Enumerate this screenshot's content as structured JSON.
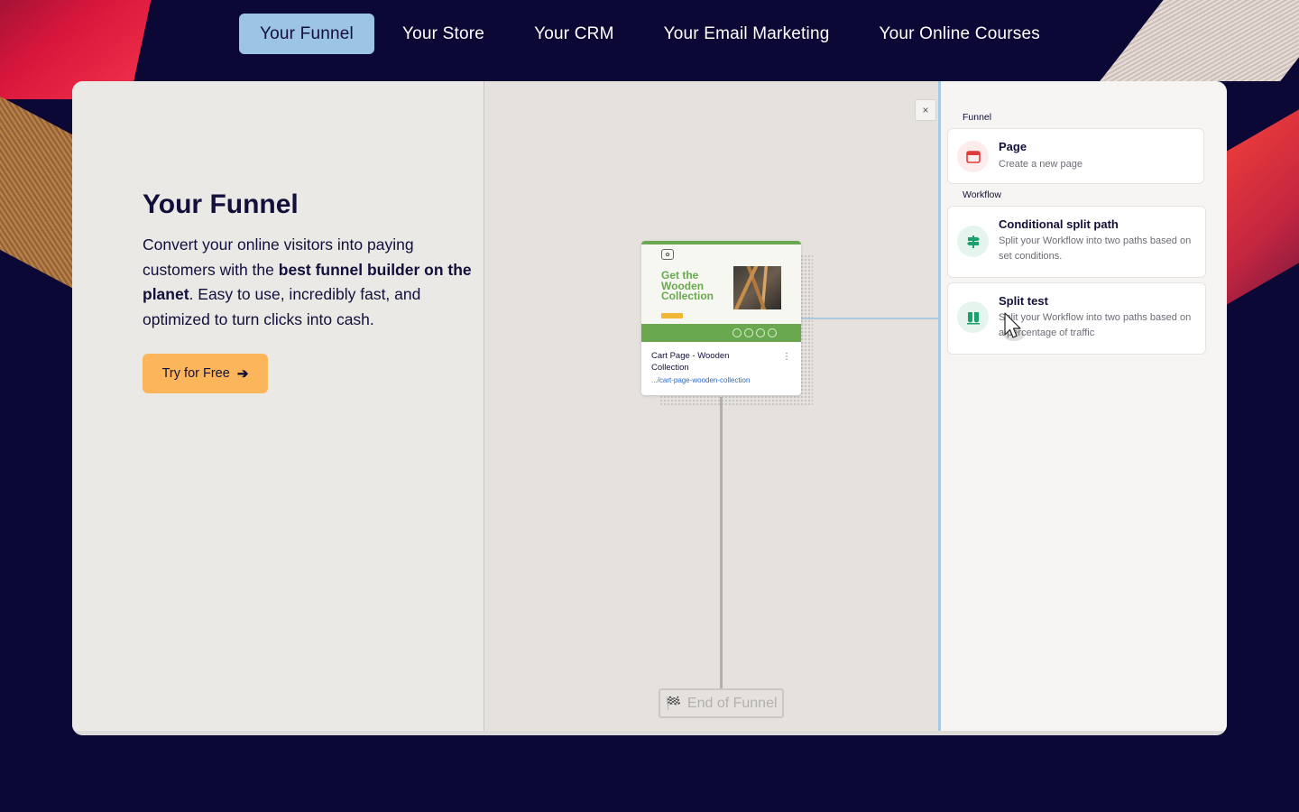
{
  "nav": {
    "tabs": [
      {
        "label": "Your Funnel",
        "active": true
      },
      {
        "label": "Your Store",
        "active": false
      },
      {
        "label": "Your CRM",
        "active": false
      },
      {
        "label": "Your Email Marketing",
        "active": false
      },
      {
        "label": "Your Online Courses",
        "active": false
      }
    ]
  },
  "hero": {
    "title": "Your Funnel",
    "desc_part1": "Convert your online visitors into paying customers with the ",
    "desc_bold": "best funnel builder on the planet",
    "desc_part2": ". Easy to use, incredibly fast, and optimized to turn clicks into cash.",
    "cta_label": "Try for Free",
    "cta_icon": "arrow-right-icon"
  },
  "canvas": {
    "close_label": "×",
    "page_card": {
      "thumb_headline": "Get the Wooden Collection",
      "title": "Cart Page - Wooden Collection",
      "link": ".../cart-page-wooden-collection",
      "menu_label": "⋮"
    },
    "end_label": "End of Funnel",
    "end_icon": "checkered-flag-icon"
  },
  "sidebar": {
    "sections": [
      {
        "label": "Funnel",
        "items": [
          {
            "title": "Page",
            "subtitle": "Create a new page",
            "icon": "browser-window-icon",
            "icon_color": "#e03a3a"
          }
        ]
      },
      {
        "label": "Workflow",
        "items": [
          {
            "title": "Conditional split path",
            "subtitle": "Split your Workflow into two paths based on set conditions.",
            "icon": "signpost-icon",
            "icon_color": "#1aa06d"
          },
          {
            "title": "Split test",
            "subtitle": "Split your Workflow into two paths based on a percentage of traffic",
            "icon": "beakers-icon",
            "icon_color": "#1aa06d"
          }
        ]
      }
    ]
  },
  "colors": {
    "background": "#0b0835",
    "active_tab": "#9cc4e4",
    "cta": "#fbb55a",
    "accent_green": "#1aa06d",
    "accent_red": "#e03a3a"
  }
}
